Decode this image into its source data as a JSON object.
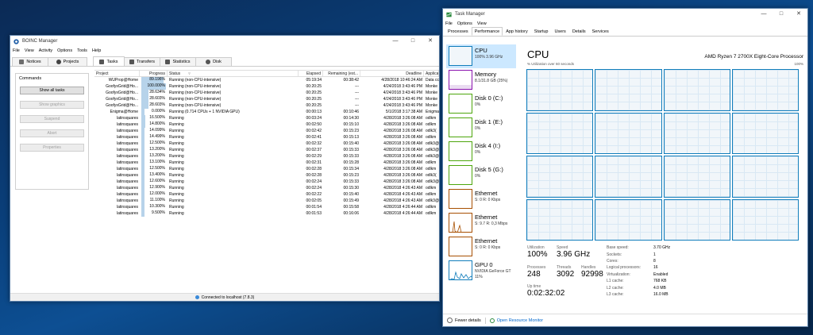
{
  "boinc": {
    "title": "BOINC Manager",
    "menu": [
      "File",
      "View",
      "Activity",
      "Options",
      "Tools",
      "Help"
    ],
    "tabs": [
      "Notices",
      "Projects",
      "Tasks",
      "Transfers",
      "Statistics",
      "Disk"
    ],
    "commands": {
      "label": "Commands",
      "buttons": [
        "Show all tasks",
        "Show graphics",
        "Suspend",
        "Abort",
        "Properties"
      ]
    },
    "columns": [
      "Project",
      "Progress",
      "Status",
      "Elapsed",
      "Remaining (est...",
      "Deadline",
      "Applica"
    ],
    "rows": [
      {
        "project": "WUProp@Home",
        "progress": "89.196%",
        "status": "Running (non-CPU-intensive)",
        "elapsed": "05:19:34",
        "remaining": "00:38:42",
        "deadline": "4/28/2018 10:46:24 AM",
        "app": "Data cc"
      },
      {
        "project": "GoofyxGrid@Ho...",
        "progress": "100.000%",
        "status": "Running (non-CPU-intensive)",
        "elapsed": "00:20:25",
        "remaining": "---",
        "deadline": "4/24/2018 3:43:46 PM",
        "app": "Monke"
      },
      {
        "project": "GoofyxGrid@Ho...",
        "progress": "28.634%",
        "status": "Running (non-CPU-intensive)",
        "elapsed": "00:20:25",
        "remaining": "---",
        "deadline": "4/24/2018 3:43:46 PM",
        "app": "Monke"
      },
      {
        "project": "GoofyxGrid@Ho...",
        "progress": "28.603%",
        "status": "Running (non-CPU-intensive)",
        "elapsed": "00:20:25",
        "remaining": "---",
        "deadline": "4/24/2018 3:43:46 PM",
        "app": "Monke"
      },
      {
        "project": "GoofyxGrid@Ho...",
        "progress": "28.603%",
        "status": "Running (non-CPU-intensive)",
        "elapsed": "00:20:25",
        "remaining": "---",
        "deadline": "4/24/2018 3:43:46 PM",
        "app": "Monke"
      },
      {
        "project": "Enigma@Home",
        "progress": "0.000%",
        "status": "Running (0.714 CPUs + 1 NVIDIA GPU)",
        "elapsed": "00:00:13",
        "remaining": "00:10:46",
        "deadline": "5/1/2018 3:17:38 AM",
        "app": "Enigma"
      },
      {
        "project": "latinsquares",
        "progress": "16.500%",
        "status": "Running",
        "elapsed": "00:03:24",
        "remaining": "00:14:30",
        "deadline": "4/28/2018 3:26:08 AM",
        "app": "odlkm"
      },
      {
        "project": "latinsquares",
        "progress": "14.800%",
        "status": "Running",
        "elapsed": "00:02:50",
        "remaining": "00:15:10",
        "deadline": "4/28/2018 3:26:08 AM",
        "app": "odlkm"
      },
      {
        "project": "latinsquares",
        "progress": "14.099%",
        "status": "Running",
        "elapsed": "00:02:42",
        "remaining": "00:15:23",
        "deadline": "4/28/2018 3:26:08 AM",
        "app": "odlk3("
      },
      {
        "project": "latinsquares",
        "progress": "14.499%",
        "status": "Running",
        "elapsed": "00:02:41",
        "remaining": "00:15:13",
        "deadline": "4/28/2018 3:26:08 AM",
        "app": "odlkm"
      },
      {
        "project": "latinsquares",
        "progress": "12.500%",
        "status": "Running",
        "elapsed": "00:02:32",
        "remaining": "00:15:40",
        "deadline": "4/28/2018 3:26:08 AM",
        "app": "odlk3@"
      },
      {
        "project": "latinsquares",
        "progress": "13.200%",
        "status": "Running",
        "elapsed": "00:02:37",
        "remaining": "00:15:33",
        "deadline": "4/28/2018 3:26:08 AM",
        "app": "odlk3@"
      },
      {
        "project": "latinsquares",
        "progress": "13.200%",
        "status": "Running",
        "elapsed": "00:02:29",
        "remaining": "00:15:33",
        "deadline": "4/28/2018 3:26:08 AM",
        "app": "odlk3@"
      },
      {
        "project": "latinsquares",
        "progress": "13.100%",
        "status": "Running",
        "elapsed": "00:02:31",
        "remaining": "00:15:28",
        "deadline": "4/28/2018 3:26:08 AM",
        "app": "odlkm"
      },
      {
        "project": "latinsquares",
        "progress": "12.500%",
        "status": "Running",
        "elapsed": "00:02:28",
        "remaining": "00:15:34",
        "deadline": "4/28/2018 3:26:08 AM",
        "app": "odlkm"
      },
      {
        "project": "latinsquares",
        "progress": "13.400%",
        "status": "Running",
        "elapsed": "00:02:28",
        "remaining": "00:15:23",
        "deadline": "4/28/2018 3:26:08 AM",
        "app": "odlk3("
      },
      {
        "project": "latinsquares",
        "progress": "12.600%",
        "status": "Running",
        "elapsed": "00:02:24",
        "remaining": "00:15:33",
        "deadline": "4/28/2018 3:26:08 AM",
        "app": "odlk3@"
      },
      {
        "project": "latinsquares",
        "progress": "12.900%",
        "status": "Running",
        "elapsed": "00:02:24",
        "remaining": "00:15:30",
        "deadline": "4/28/2018 4:26:43 AM",
        "app": "odlkm"
      },
      {
        "project": "latinsquares",
        "progress": "12.000%",
        "status": "Running",
        "elapsed": "00:02:22",
        "remaining": "00:15:40",
        "deadline": "4/28/2018 4:26:43 AM",
        "app": "odlkm"
      },
      {
        "project": "latinsquares",
        "progress": "11.100%",
        "status": "Running",
        "elapsed": "00:02:05",
        "remaining": "00:15:49",
        "deadline": "4/28/2018 4:26:43 AM",
        "app": "odlk3@"
      },
      {
        "project": "latinsquares",
        "progress": "10.300%",
        "status": "Running",
        "elapsed": "00:01:54",
        "remaining": "00:15:58",
        "deadline": "4/28/2018 4:26:44 AM",
        "app": "odlkm"
      },
      {
        "project": "latinsquares",
        "progress": "9.500%",
        "status": "Running",
        "elapsed": "00:01:53",
        "remaining": "00:16:06",
        "deadline": "4/28/2018 4:26:44 AM",
        "app": "odlkm"
      }
    ],
    "statusbar": "Connected to localhost (7.8.3)"
  },
  "tm": {
    "title": "Task Manager",
    "menu": [
      "File",
      "Options",
      "View"
    ],
    "tabs": [
      "Processes",
      "Performance",
      "App history",
      "Startup",
      "Users",
      "Details",
      "Services"
    ],
    "sidebar": [
      {
        "name": "CPU",
        "value": "100% 3.96 GHz",
        "color": "#117dbb"
      },
      {
        "name": "Memory",
        "value": "8.1/31.8 GB (25%)",
        "color": "#8b12ae"
      },
      {
        "name": "Disk 0 (C:)",
        "value": "0%",
        "color": "#4da60c"
      },
      {
        "name": "Disk 1 (E:)",
        "value": "0%",
        "color": "#4da60c"
      },
      {
        "name": "Disk 4 (I:)",
        "value": "0%",
        "color": "#4da60c"
      },
      {
        "name": "Disk 5 (G:)",
        "value": "0%",
        "color": "#4da60c"
      },
      {
        "name": "Ethernet",
        "value": "S: 0 R: 0 Kbps",
        "color": "#a74f01"
      },
      {
        "name": "Ethernet",
        "value": "S: 9.7 R: 0,3 Mbps",
        "color": "#a74f01"
      },
      {
        "name": "Ethernet",
        "value": "S: 0 R: 0 Kbps",
        "color": "#a74f01"
      },
      {
        "name": "GPU 0",
        "value": "NVIDIA GeForce GT",
        "value2": "11%",
        "color": "#117dbb"
      }
    ],
    "main": {
      "title": "CPU",
      "processor": "AMD Ryzen 7 2700X Eight-Core Processor",
      "util_label": "% Utilization over 60 seconds",
      "util_max": "100%"
    },
    "stats": {
      "utilization_label": "Utilization",
      "utilization": "100%",
      "speed_label": "Speed",
      "speed": "3.96 GHz",
      "processes_label": "Processes",
      "processes": "248",
      "threads_label": "Threads",
      "threads": "3092",
      "handles_label": "Handles",
      "handles": "92998",
      "uptime_label": "Up time",
      "uptime": "0:02:32:02"
    },
    "specs": [
      {
        "k": "Base speed:",
        "v": "3.70 GHz"
      },
      {
        "k": "Sockets:",
        "v": "1"
      },
      {
        "k": "Cores:",
        "v": "8"
      },
      {
        "k": "Logical processors:",
        "v": "16"
      },
      {
        "k": "Virtualization:",
        "v": "Enabled"
      },
      {
        "k": "L1 cache:",
        "v": "768 KB"
      },
      {
        "k": "L2 cache:",
        "v": "4.0 MB"
      },
      {
        "k": "L3 cache:",
        "v": "16.0 MB"
      }
    ],
    "footer": {
      "fewer": "Fewer details",
      "monitor": "Open Resource Monitor"
    }
  }
}
